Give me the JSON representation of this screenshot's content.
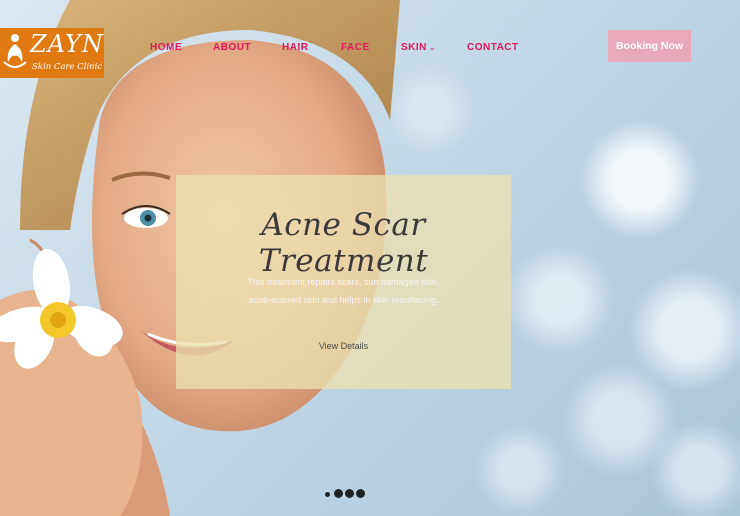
{
  "logo": {
    "name": "ZAYN",
    "tagline": "Skin Care Clinic",
    "brand_color": "#e07a10"
  },
  "nav": {
    "home": "HOME",
    "about": "ABOUT",
    "hair": "HAIR",
    "face": "FACE",
    "skin": "SKIN",
    "contact": "CONTACT",
    "color": "#e0195a"
  },
  "booking": {
    "label": "Booking Now",
    "color": "#e8a9ba"
  },
  "slide": {
    "title": "Acne Scar Treatment",
    "text_line1": "This treatment repairs scars, sun damaged skin,",
    "text_line2": "acne-scarred skin and helps in skin resurfacing.",
    "link": "View Details"
  },
  "carousel": {
    "slide_count": 4,
    "active_index": 0
  }
}
